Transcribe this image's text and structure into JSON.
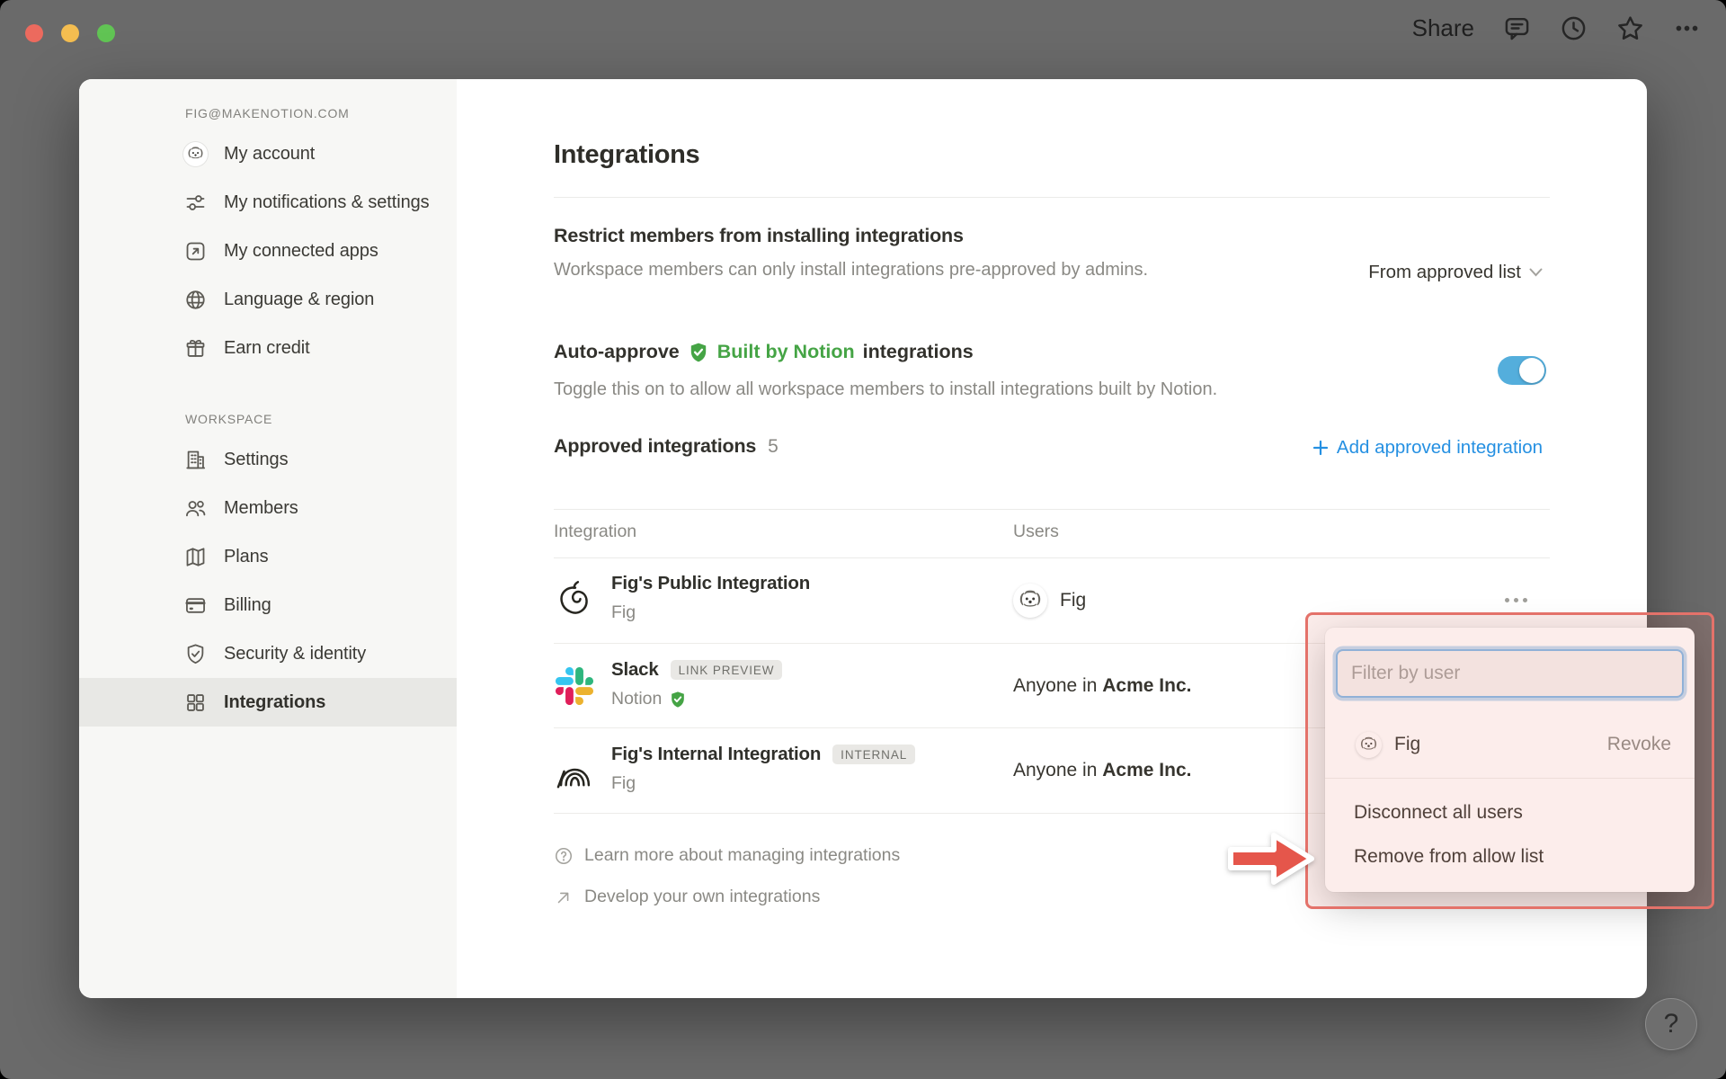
{
  "titlebar": {
    "share": "Share"
  },
  "sidebar": {
    "email": "FIG@MAKENOTION.COM",
    "account_items": [
      "My account",
      "My notifications & settings",
      "My connected apps",
      "Language & region",
      "Earn credit"
    ],
    "workspace_heading": "WORKSPACE",
    "workspace_items": [
      "Settings",
      "Members",
      "Plans",
      "Billing",
      "Security & identity",
      "Integrations"
    ],
    "selected_item": "Integrations"
  },
  "main": {
    "title": "Integrations",
    "restrict_heading": "Restrict members from installing integrations",
    "restrict_description": "Workspace members can only install integrations pre-approved by admins.",
    "restrict_dropdown_value": "From approved list",
    "auto_approve_prefix": "Auto-approve",
    "auto_approve_badge": "Built by Notion",
    "auto_approve_suffix": "integrations",
    "auto_approve_description": "Toggle this on to allow all workspace members to install integrations built by Notion.",
    "auto_approve_enabled": true,
    "approved_heading": "Approved integrations",
    "approved_count": "5",
    "add_button": "Add approved integration",
    "table": {
      "col_integration": "Integration",
      "col_users": "Users",
      "rows": [
        {
          "name": "Fig's Public Integration",
          "subtitle": "Fig",
          "users_name": "Fig"
        },
        {
          "name": "Slack",
          "badge": "LINK PREVIEW",
          "subtitle": "Notion",
          "users_prefix": "Anyone in ",
          "users_org": "Acme Inc."
        },
        {
          "name": "Fig's Internal Integration",
          "badge": "INTERNAL",
          "subtitle": "Fig",
          "users_prefix": "Anyone in ",
          "users_org": "Acme Inc."
        }
      ]
    },
    "footer_links": [
      "Learn more about managing integrations",
      "Develop your own integrations"
    ]
  },
  "popup": {
    "filter_placeholder": "Filter by user",
    "user_name": "Fig",
    "revoke_label": "Revoke",
    "disconnect_label": "Disconnect all users",
    "remove_label": "Remove from allow list"
  },
  "help_button": "?",
  "colors": {
    "accent_blue": "#2590E2",
    "toggle_blue": "#54AEDC",
    "verified_green": "#45A445",
    "annotation_red": "#E4726A",
    "arrow_red": "#E5564B",
    "sidebar_bg": "#F7F7F5",
    "backdrop": "#6A6A6A",
    "slack_blue": "#36C5F0",
    "slack_green": "#2EB67D",
    "slack_yellow": "#ECB22E",
    "slack_red": "#E01E5A",
    "traffic_red": "#EC6A5E",
    "traffic_yellow": "#F4BD50",
    "traffic_green": "#61C454"
  }
}
